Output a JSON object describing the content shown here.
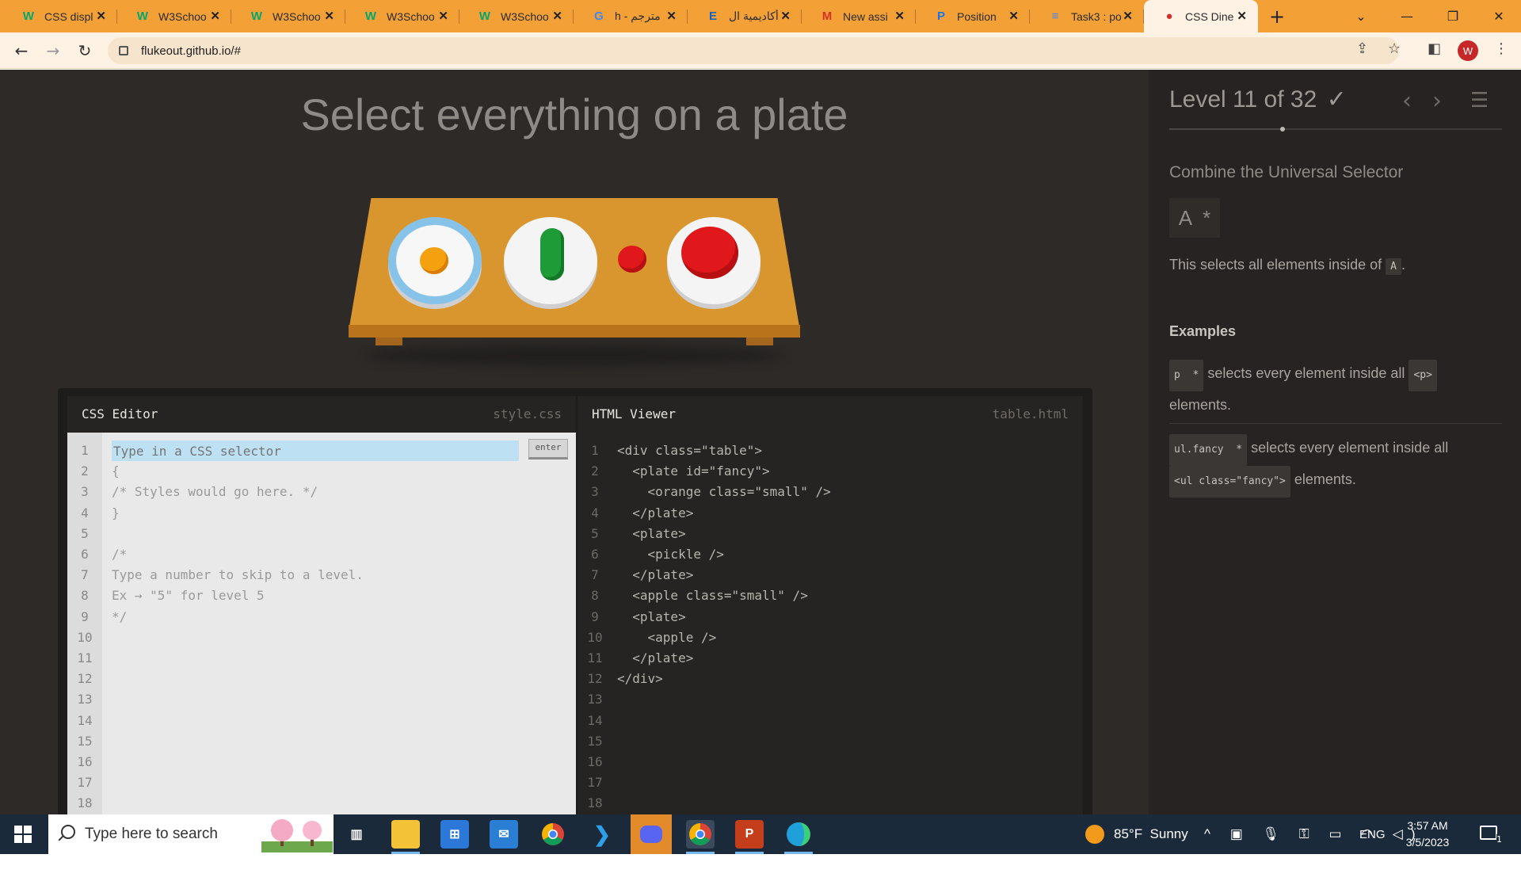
{
  "browser": {
    "tabs": [
      {
        "title": "CSS displ",
        "favicon": "w3schools-icon",
        "color": "#04aa6d",
        "glyph": "W"
      },
      {
        "title": "W3Schoo",
        "favicon": "w3schools-icon",
        "color": "#04aa6d",
        "glyph": "W"
      },
      {
        "title": "W3Schoo",
        "favicon": "w3schools-icon",
        "color": "#04aa6d",
        "glyph": "W"
      },
      {
        "title": "W3Schoo",
        "favicon": "w3schools-icon",
        "color": "#04aa6d",
        "glyph": "W"
      },
      {
        "title": "W3Schoo",
        "favicon": "w3schools-icon",
        "color": "#04aa6d",
        "glyph": "W"
      },
      {
        "title": "h - مترجم",
        "favicon": "google-icon",
        "color": "#4285f4",
        "glyph": "G"
      },
      {
        "title": "أكاديمية ال",
        "favicon": "e-icon",
        "color": "#1565c0",
        "glyph": "E"
      },
      {
        "title": "New assi",
        "favicon": "gmail-icon",
        "color": "#d93025",
        "glyph": "M"
      },
      {
        "title": "Position",
        "favicon": "contacts-icon",
        "color": "#1a73e8",
        "glyph": "P"
      },
      {
        "title": "Task3 : po",
        "favicon": "docs-icon",
        "color": "#4285f4",
        "glyph": "≡"
      },
      {
        "title": "CSS Dine",
        "favicon": "css-diner-icon",
        "color": "#d32f2f",
        "glyph": "●",
        "active": true
      }
    ],
    "url": "flukeout.github.io/#",
    "profile_initial": "W"
  },
  "game": {
    "instruction": "Select everything on a plate",
    "level_label": "Level 11 of 32",
    "level_check": "✓",
    "progress": 0.34,
    "selector_name": "Combine the Universal Selector",
    "syntax": "A  *",
    "hint_before": "This selects all elements inside of",
    "hint_chip": "A",
    "hint_after": ".",
    "examples_title": "Examples",
    "example1_chip": "p  *",
    "example1_text": " selects every element inside all ",
    "example1_chip2": "<p>",
    "example1_after": " elements.",
    "example2_chip": "ul.fancy  *",
    "example2_text": " selects every element inside all ",
    "example2_chip2": "<ul class=\"fancy\">",
    "example2_after": " elements."
  },
  "css_editor": {
    "title": "CSS Editor",
    "file": "style.css",
    "placeholder": "Type in a CSS selector",
    "enter_label": "enter",
    "line_numbers": "1\n2\n3\n4\n5\n6\n7\n8\n9\n10\n11\n12\n13\n14\n15\n16\n17\n18",
    "code": "\n{\n/* Styles would go here. */\n}\n\n/*\nType a number to skip to a level.\nEx → \"5\" for level 5\n*/"
  },
  "html_viewer": {
    "title": "HTML Viewer",
    "file": "table.html",
    "line_numbers": "1\n2\n3\n4\n5\n6\n7\n8\n9\n10\n11\n12\n13\n14\n15\n16\n17\n18",
    "code": "<div class=\"table\">\n  <plate id=\"fancy\">\n    <orange class=\"small\" />\n  </plate>\n  <plate>\n    <pickle />\n  </plate>\n  <apple class=\"small\" />\n  <plate>\n    <apple />\n  </plate>\n</div>"
  },
  "taskbar": {
    "search_placeholder": "Type here to search",
    "weather": "85°F  Sunny",
    "language": "ENG",
    "time": "3:57 AM",
    "date": "3/5/2023",
    "notification_count": "1"
  }
}
